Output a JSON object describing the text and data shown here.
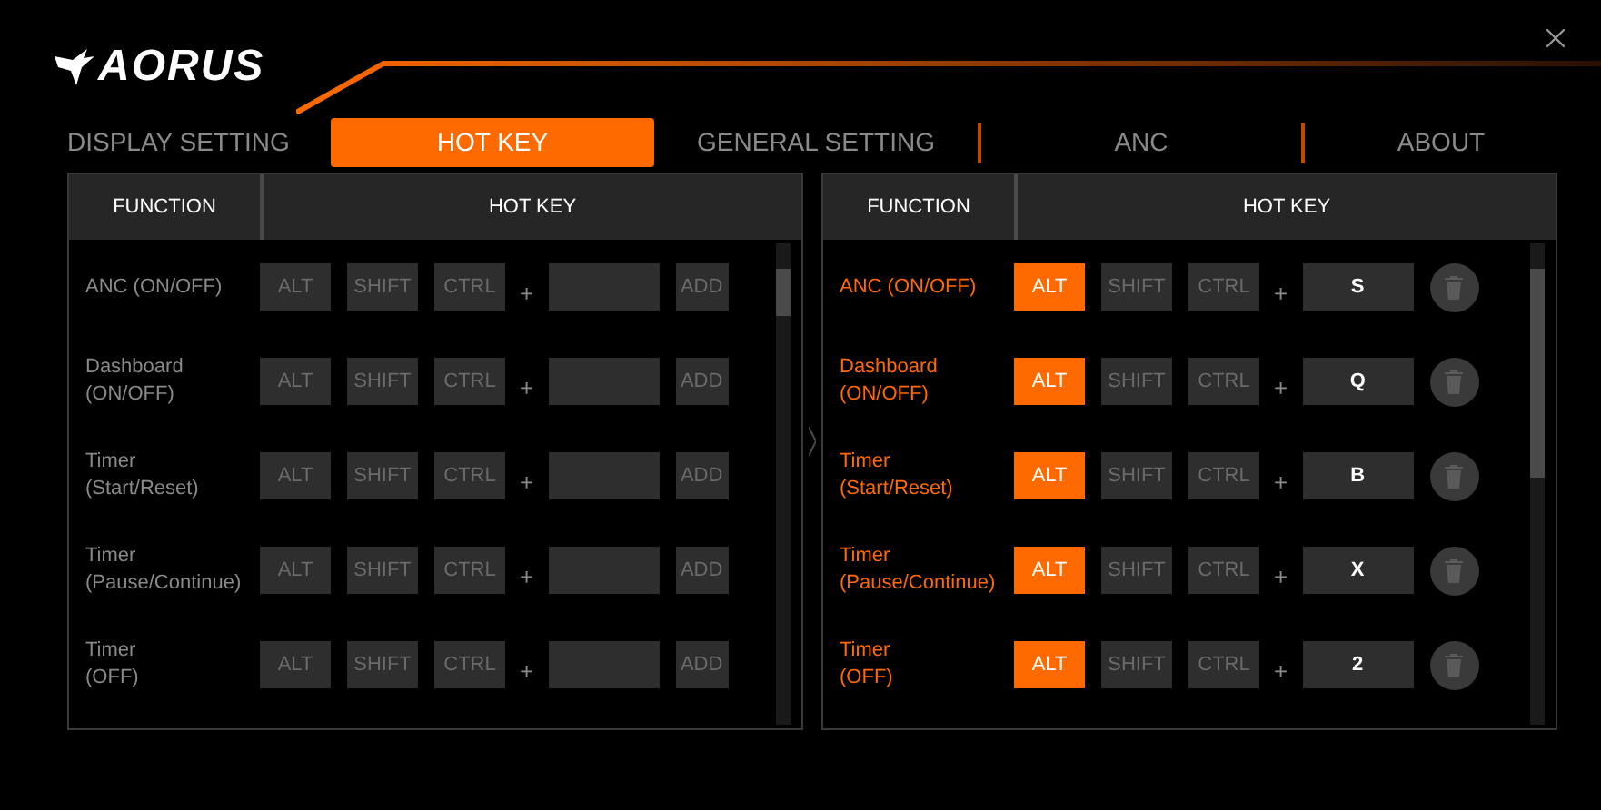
{
  "window": {
    "logo": "AORUS"
  },
  "tabs": [
    {
      "label": "DISPLAY SETTING",
      "selected": false
    },
    {
      "label": "HOT KEY",
      "selected": true
    },
    {
      "label": "GENERAL SETTING",
      "selected": false
    },
    {
      "label": "ANC",
      "selected": false
    },
    {
      "label": "ABOUT",
      "selected": false
    }
  ],
  "panels": [
    {
      "columns": [
        "FUNCTION",
        "HOT KEY"
      ],
      "rows": [
        {
          "kind": "unassigned",
          "function": "ANC (ON/OFF)",
          "modifiers": [
            {
              "label": "ALT",
              "on": false
            },
            {
              "label": "SHIFT",
              "on": false
            },
            {
              "label": "CTRL",
              "on": false
            }
          ],
          "joiner": "+",
          "action": "ADD"
        },
        {
          "kind": "unassigned",
          "function": "Dashboard\n(ON/OFF)",
          "modifiers": [
            {
              "label": "ALT",
              "on": false
            },
            {
              "label": "SHIFT",
              "on": false
            },
            {
              "label": "CTRL",
              "on": false
            }
          ],
          "joiner": "+",
          "action": "ADD"
        },
        {
          "kind": "unassigned",
          "function": "Timer\n(Start/Reset)",
          "modifiers": [
            {
              "label": "ALT",
              "on": false
            },
            {
              "label": "SHIFT",
              "on": false
            },
            {
              "label": "CTRL",
              "on": false
            }
          ],
          "joiner": "+",
          "action": "ADD"
        },
        {
          "kind": "unassigned",
          "function": "Timer\n(Pause/Continue)",
          "modifiers": [
            {
              "label": "ALT",
              "on": false
            },
            {
              "label": "SHIFT",
              "on": false
            },
            {
              "label": "CTRL",
              "on": false
            }
          ],
          "joiner": "+",
          "action": "ADD"
        },
        {
          "kind": "unassigned",
          "function": "Timer\n(OFF)",
          "modifiers": [
            {
              "label": "ALT",
              "on": false
            },
            {
              "label": "SHIFT",
              "on": false
            },
            {
              "label": "CTRL",
              "on": false
            }
          ],
          "joiner": "+",
          "action": "ADD"
        }
      ]
    },
    {
      "columns": [
        "FUNCTION",
        "HOT KEY"
      ],
      "rows": [
        {
          "kind": "assigned",
          "function": "ANC (ON/OFF)",
          "modifiers": [
            {
              "label": "ALT",
              "on": true
            },
            {
              "label": "SHIFT",
              "on": false
            },
            {
              "label": "CTRL",
              "on": false
            }
          ],
          "joiner": "+",
          "key": "S"
        },
        {
          "kind": "assigned",
          "function": "Dashboard\n(ON/OFF)",
          "modifiers": [
            {
              "label": "ALT",
              "on": true
            },
            {
              "label": "SHIFT",
              "on": false
            },
            {
              "label": "CTRL",
              "on": false
            }
          ],
          "joiner": "+",
          "key": "Q"
        },
        {
          "kind": "assigned",
          "function": "Timer\n(Start/Reset)",
          "modifiers": [
            {
              "label": "ALT",
              "on": true
            },
            {
              "label": "SHIFT",
              "on": false
            },
            {
              "label": "CTRL",
              "on": false
            }
          ],
          "joiner": "+",
          "key": "B"
        },
        {
          "kind": "assigned",
          "function": "Timer\n(Pause/Continue)",
          "modifiers": [
            {
              "label": "ALT",
              "on": true
            },
            {
              "label": "SHIFT",
              "on": false
            },
            {
              "label": "CTRL",
              "on": false
            }
          ],
          "joiner": "+",
          "key": "X"
        },
        {
          "kind": "assigned",
          "function": "Timer\n(OFF)",
          "modifiers": [
            {
              "label": "ALT",
              "on": true
            },
            {
              "label": "SHIFT",
              "on": false
            },
            {
              "label": "CTRL",
              "on": false
            }
          ],
          "joiner": "+",
          "key": "2"
        }
      ]
    }
  ]
}
